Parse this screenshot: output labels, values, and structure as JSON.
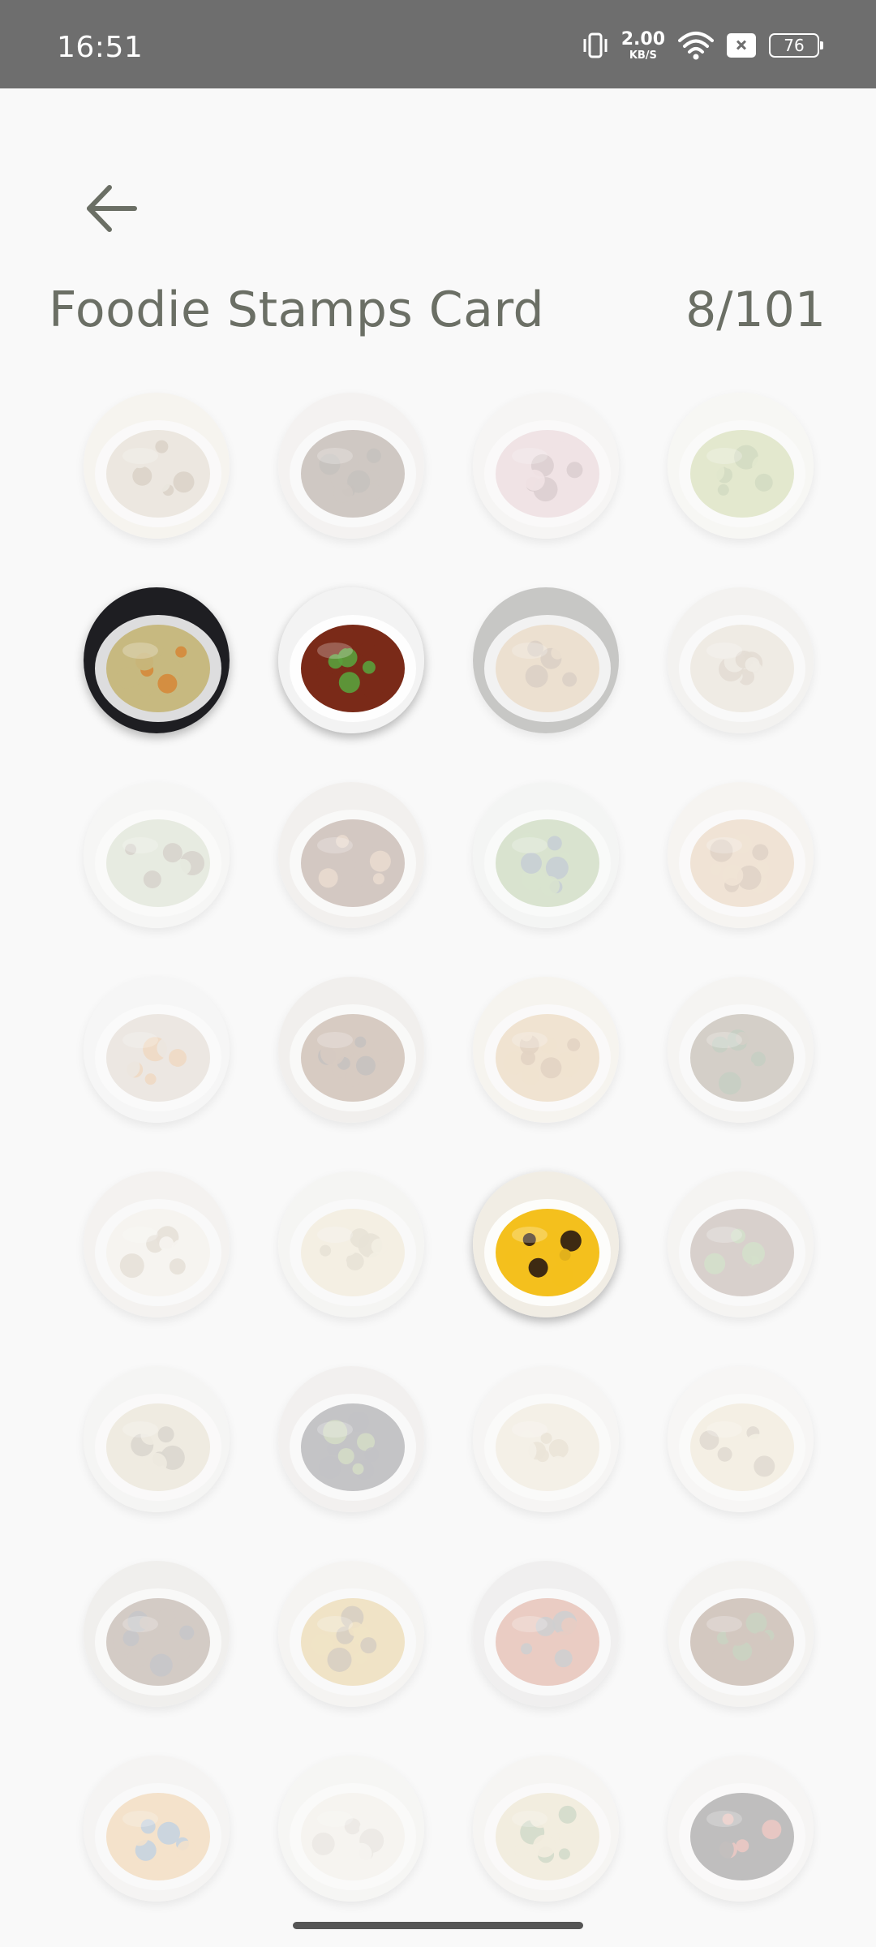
{
  "status_bar": {
    "time": "16:51",
    "net_speed": "2.00",
    "net_speed_unit": "KB/S",
    "battery": "76",
    "icons": [
      "vibrate-icon",
      "wifi-icon",
      "sim-off-icon",
      "battery-icon"
    ]
  },
  "header": {
    "back_icon": "arrow-left-icon",
    "title": "Foodie Stamps Card",
    "count": "8/101"
  },
  "stamps": [
    {
      "dish": "soup-dumpling-plates",
      "collected": false,
      "colors": [
        "#efe6d6",
        "#c9b89a",
        "#8b6a45"
      ]
    },
    {
      "dish": "braised-noodles-bowl",
      "collected": false,
      "colors": [
        "#e7e2dc",
        "#5a3e2b",
        "#3a2a1c"
      ]
    },
    {
      "dish": "sliced-pork-dish",
      "collected": false,
      "colors": [
        "#f1ece8",
        "#d9a5ae",
        "#8c5c62"
      ]
    },
    {
      "dish": "stir-fried-greens",
      "collected": false,
      "colors": [
        "#f4f2e6",
        "#a6bb58",
        "#6e8c2c"
      ]
    },
    {
      "dish": "oyster-vermicelli",
      "collected": true,
      "colors": [
        "#1e1e22",
        "#c7b980",
        "#d58a3a"
      ]
    },
    {
      "dish": "braised-pork-rice",
      "collected": true,
      "colors": [
        "#f3f3f3",
        "#7a2a18",
        "#5aa03c"
      ]
    },
    {
      "dish": "tofu-cubes",
      "collected": false,
      "colors": [
        "#3d3a36",
        "#c99a5e",
        "#8b6238"
      ]
    },
    {
      "dish": "bubble-milk-tea",
      "collected": false,
      "colors": [
        "#e4dfd8",
        "#d6c6ac",
        "#a98f6e"
      ]
    },
    {
      "dish": "steamed-buns",
      "collected": false,
      "colors": [
        "#eef1ec",
        "#b8c7a0",
        "#7c6a52"
      ]
    },
    {
      "dish": "herbal-soup",
      "collected": false,
      "colors": [
        "#e2d9d0",
        "#6b3e28",
        "#c08a5c"
      ]
    },
    {
      "dish": "cucumber-salad",
      "collected": false,
      "colors": [
        "#e9ede9",
        "#7fa85a",
        "#3e5a70"
      ]
    },
    {
      "dish": "toast-box",
      "collected": false,
      "colors": [
        "#f0e8dc",
        "#d9a873",
        "#9b6a3e"
      ]
    },
    {
      "dish": "rice-noodle-salad",
      "collected": false,
      "colors": [
        "#eef0ef",
        "#c9b7a4",
        "#d6832f"
      ]
    },
    {
      "dish": "stewed-eggplant-pot",
      "collected": false,
      "colors": [
        "#ddd5cc",
        "#7a4a2a",
        "#3a2a22"
      ]
    },
    {
      "dish": "fried-chicken-cutlet",
      "collected": false,
      "colors": [
        "#f1e7d6",
        "#d9a561",
        "#a56b2f"
      ]
    },
    {
      "dish": "beef-soup",
      "collected": false,
      "colors": [
        "#ece7e1",
        "#6e5a3e",
        "#3a5a30"
      ]
    },
    {
      "dish": "bean-sprouts",
      "collected": false,
      "colors": [
        "#e6e0da",
        "#efe9d8",
        "#b59e80"
      ]
    },
    {
      "dish": "rolled-pancakes",
      "collected": false,
      "colors": [
        "#eceae4",
        "#e6d3a7",
        "#b8a478"
      ]
    },
    {
      "dish": "taro-ball-dessert",
      "collected": true,
      "colors": [
        "#f1ede4",
        "#f4c01d",
        "#2a1a12"
      ]
    },
    {
      "dish": "mixed-platter",
      "collected": false,
      "colors": [
        "#eae6e2",
        "#7d6050",
        "#6e9a4a"
      ]
    },
    {
      "dish": "wonton-soup",
      "collected": false,
      "colors": [
        "#edeae6",
        "#d4c49e",
        "#8a7a5c"
      ]
    },
    {
      "dish": "mussels-plate",
      "collected": false,
      "colors": [
        "#e2dad3",
        "#2f2f38",
        "#6b8a3a"
      ]
    },
    {
      "dish": "fried-rice",
      "collected": false,
      "colors": [
        "#f0ede8",
        "#e8d9b8",
        "#c7ad7e"
      ]
    },
    {
      "dish": "noodle-soup",
      "collected": false,
      "colors": [
        "#f2efea",
        "#e8d6aa",
        "#9e8a66"
      ]
    },
    {
      "dish": "stir-fry-pan",
      "collected": false,
      "colors": [
        "#d9d3cd",
        "#6a4a34",
        "#3a3a46"
      ]
    },
    {
      "dish": "grilled-corn",
      "collected": false,
      "colors": [
        "#ece8e0",
        "#d8a838",
        "#7a5a2a"
      ]
    },
    {
      "dish": "grilled-sausages",
      "collected": false,
      "colors": [
        "#d9d6d4",
        "#c0502e",
        "#5a5a60"
      ]
    },
    {
      "dish": "stir-fried-pork",
      "collected": false,
      "colors": [
        "#e9e3dd",
        "#6a3e22",
        "#4a6a2a"
      ]
    },
    {
      "dish": "egg-drop-soup",
      "collected": false,
      "colors": [
        "#ece8e4",
        "#e6a24a",
        "#3a6a9a"
      ]
    },
    {
      "dish": "tofu-block",
      "collected": false,
      "colors": [
        "#f1efe9",
        "#efe8d8",
        "#c8bfae"
      ]
    },
    {
      "dish": "congee",
      "collected": false,
      "colors": [
        "#efebe4",
        "#e2cc96",
        "#6a8a4a"
      ]
    },
    {
      "dish": "olives-platter",
      "collected": false,
      "colors": [
        "#eeeae6",
        "#1f1a1a",
        "#c8402e"
      ]
    }
  ]
}
